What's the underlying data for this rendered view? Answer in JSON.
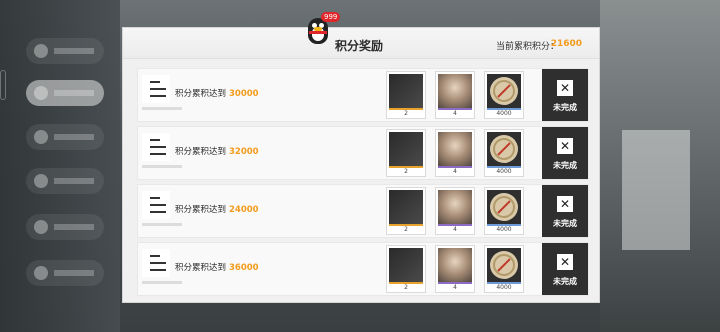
{
  "header": {
    "title": "积分奖励",
    "score_label": "当前累积积分：",
    "score_value": "21600",
    "badge": "999"
  },
  "rows": [
    {
      "label": "积分累积达到",
      "target": "30000",
      "rewards": [
        {
          "name": "pen-item",
          "count": "2"
        },
        {
          "name": "character-portrait",
          "count": "4"
        },
        {
          "name": "gold-coin",
          "count": "4000"
        }
      ],
      "status": "未完成"
    },
    {
      "label": "积分累积达到",
      "target": "32000",
      "rewards": [
        {
          "name": "pen-item",
          "count": "2"
        },
        {
          "name": "character-portrait",
          "count": "4"
        },
        {
          "name": "gold-coin",
          "count": "4000"
        }
      ],
      "status": "未完成"
    },
    {
      "label": "积分累积达到",
      "target": "24000",
      "rewards": [
        {
          "name": "pen-item",
          "count": "2"
        },
        {
          "name": "character-portrait",
          "count": "4"
        },
        {
          "name": "gold-coin",
          "count": "4000"
        }
      ],
      "status": "未完成"
    },
    {
      "label": "积分累积达到",
      "target": "36000",
      "rewards": [
        {
          "name": "pen-item",
          "count": "2"
        },
        {
          "name": "character-portrait",
          "count": "4"
        },
        {
          "name": "gold-coin",
          "count": "4000"
        }
      ],
      "status": "未完成"
    }
  ],
  "colors": {
    "accent": "#f29b1c",
    "status_bg": "#2f2f2f"
  }
}
